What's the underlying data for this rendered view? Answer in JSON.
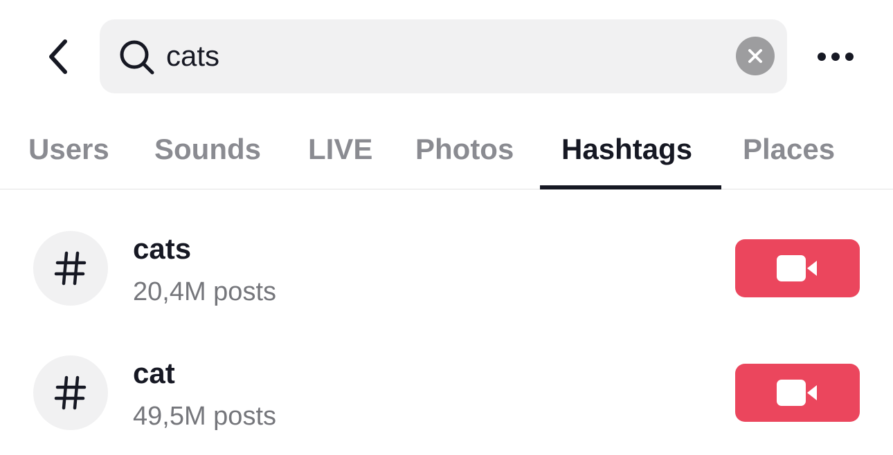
{
  "search": {
    "value": "cats",
    "placeholder": "Search"
  },
  "tabs": [
    {
      "label": "Users",
      "active": false
    },
    {
      "label": "Sounds",
      "active": false
    },
    {
      "label": "LIVE",
      "active": false
    },
    {
      "label": "Photos",
      "active": false
    },
    {
      "label": "Hashtags",
      "active": true
    },
    {
      "label": "Places",
      "active": false
    }
  ],
  "results": [
    {
      "icon": "hashtag-icon",
      "name": "cats",
      "posts": "20,4M posts",
      "action_icon": "video-camera-icon"
    },
    {
      "icon": "hashtag-icon",
      "name": "cat",
      "posts": "49,5M posts",
      "action_icon": "video-camera-icon"
    }
  ],
  "colors": {
    "accent": "#eb465d",
    "text_primary": "#161823",
    "text_secondary": "#75767b",
    "tab_inactive": "#8a8b91",
    "search_bg": "#f1f1f2"
  }
}
